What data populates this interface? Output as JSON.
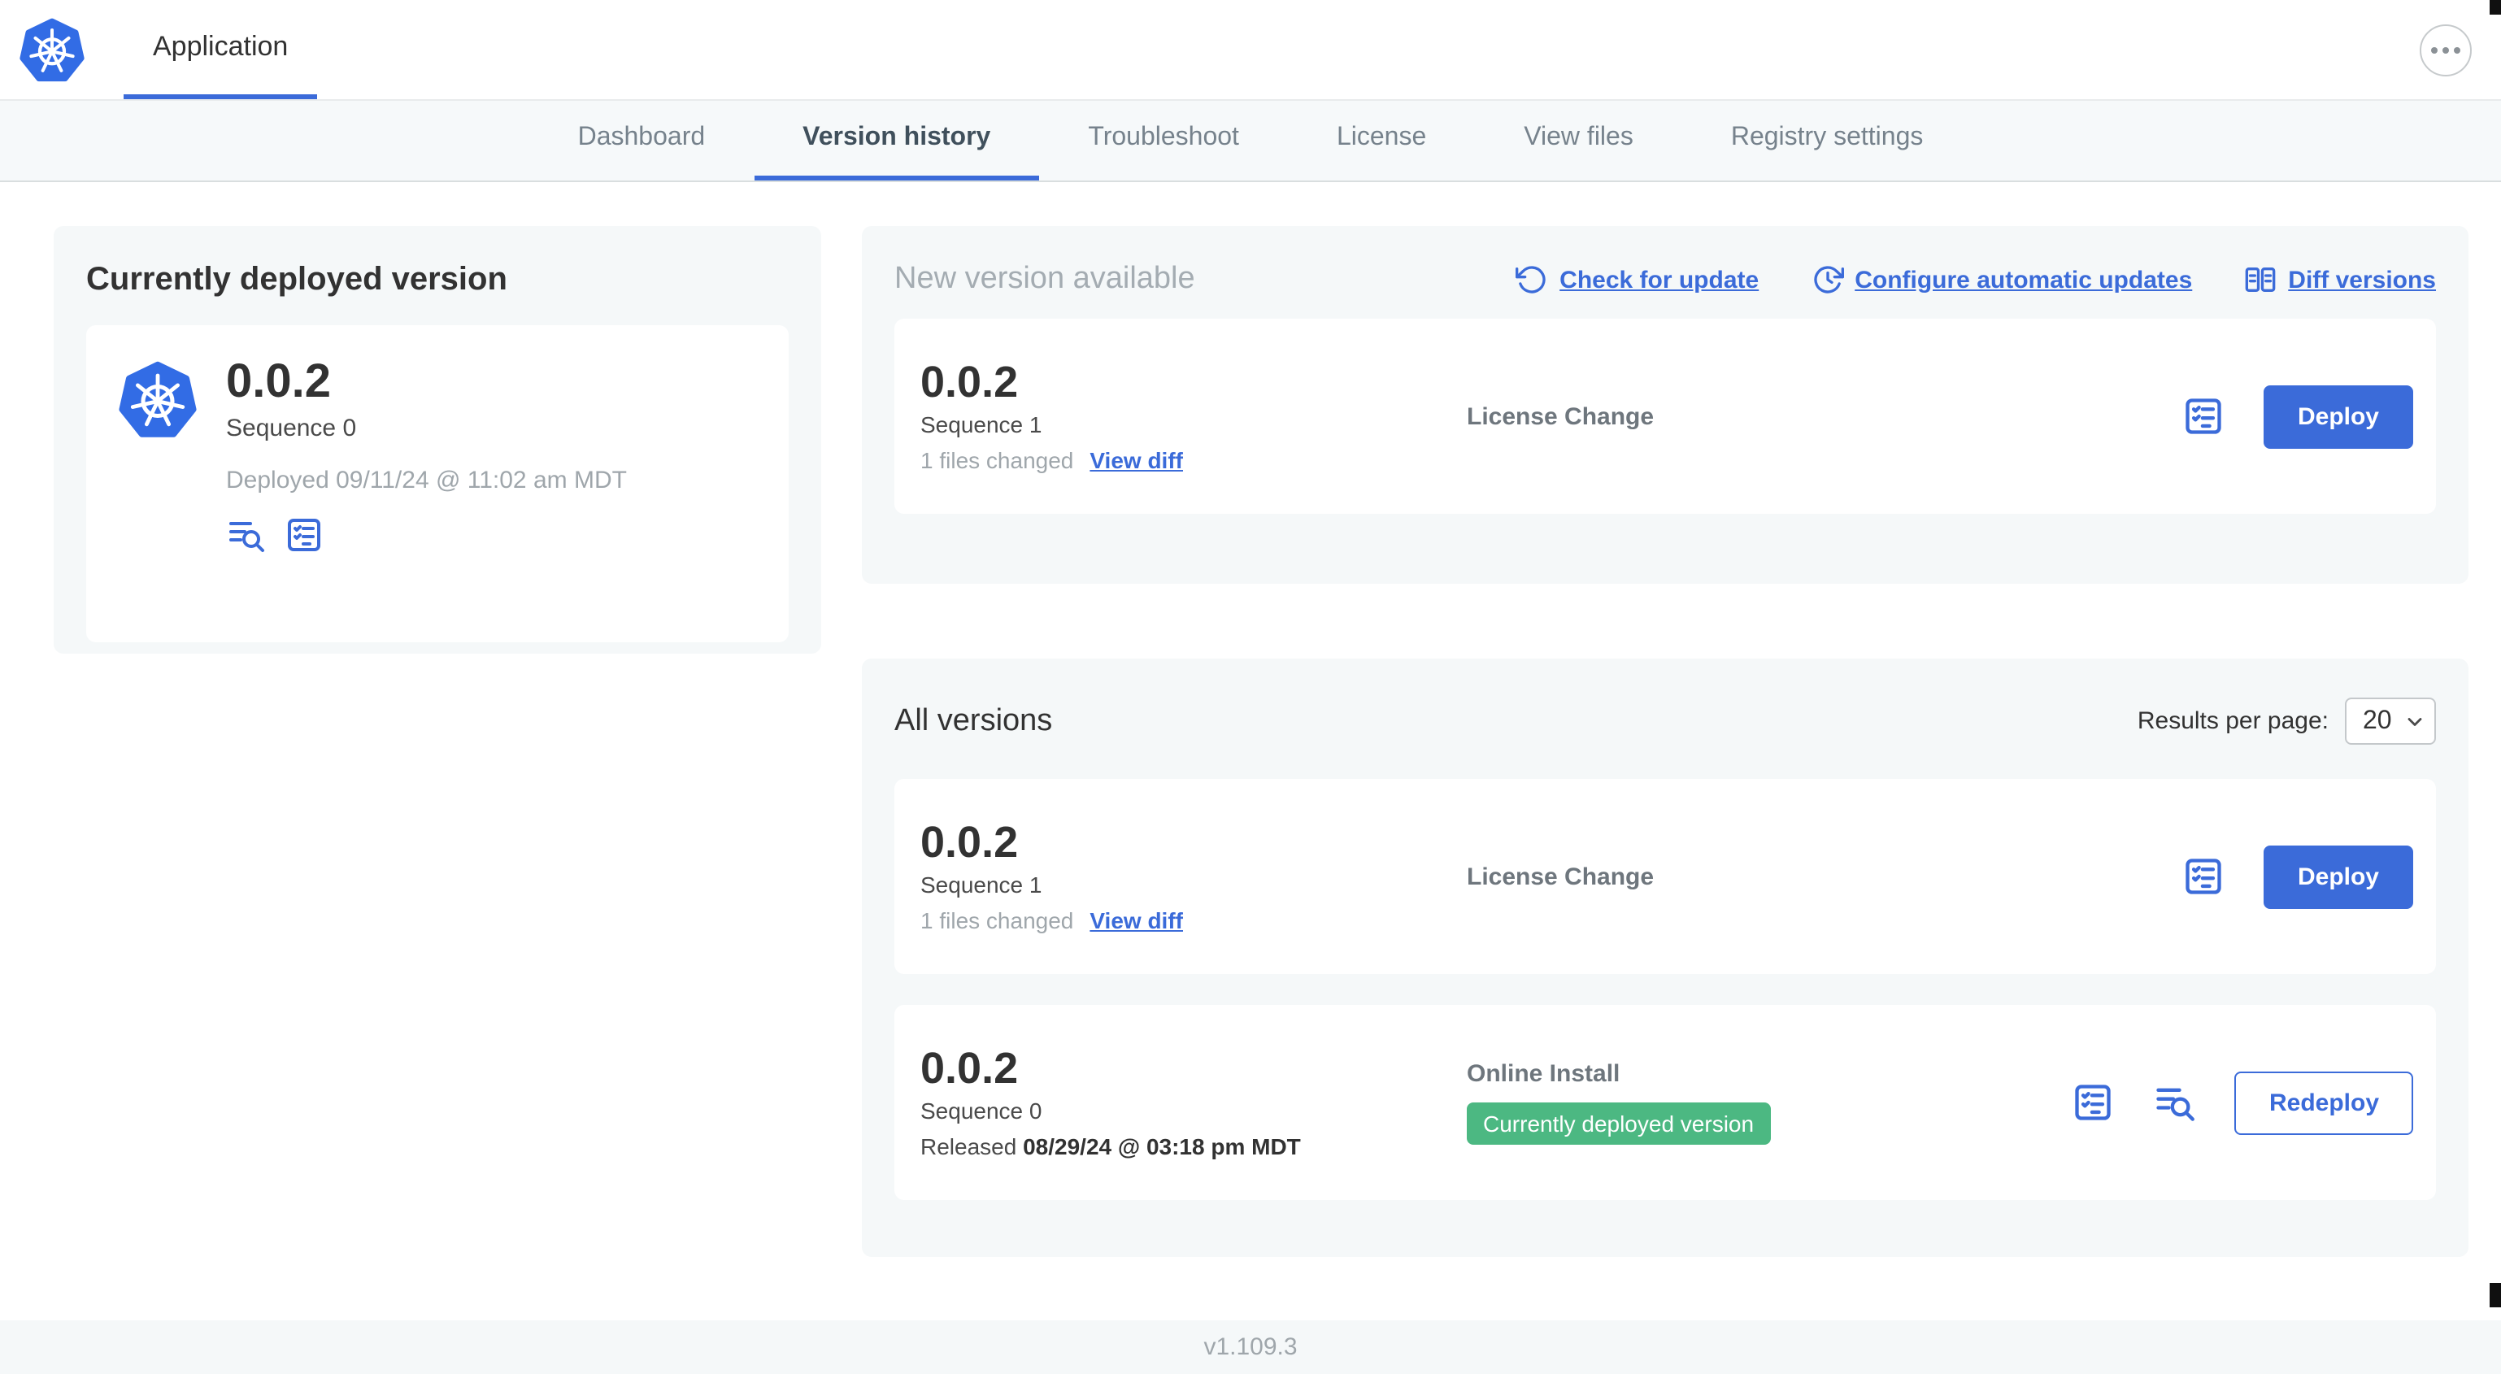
{
  "colors": {
    "accent_blue": "#3b6bd9",
    "logo_blue": "#326ce5",
    "badge_green": "#4cb882",
    "card_background": "#f5f8f9",
    "text_dark": "#323232",
    "text_muted": "#9fa6ab"
  },
  "header": {
    "app_label": "Application",
    "more_icon": "ellipsis-icon"
  },
  "nav": {
    "tabs": [
      "Dashboard",
      "Version history",
      "Troubleshoot",
      "License",
      "View files",
      "Registry settings"
    ],
    "active_tab": "Version history"
  },
  "current_version": {
    "title": "Currently deployed version",
    "version": "0.0.2",
    "sequence": "Sequence 0",
    "deployed": "Deployed 09/11/24 @ 11:02 am MDT",
    "icons": [
      "deploy-logs-icon",
      "preflight-checks-icon"
    ]
  },
  "new_version": {
    "title": "New version available",
    "check_for_update": "Check for update",
    "configure_auto_updates": "Configure automatic updates",
    "diff_versions": "Diff versions",
    "version": "0.0.2",
    "sequence": "Sequence 1",
    "files_changed": "1 files changed",
    "view_diff": "View diff",
    "source": "License Change",
    "deploy_label": "Deploy"
  },
  "all_versions": {
    "title": "All versions",
    "results_per_page_label": "Results per page:",
    "per_page": "20",
    "rows": [
      {
        "version": "0.0.2",
        "sequence": "Sequence 1",
        "files_changed": "1 files changed",
        "view_diff": "View diff",
        "source": "License Change",
        "action_label": "Deploy"
      },
      {
        "version": "0.0.2",
        "sequence": "Sequence 0",
        "released_label": "Released",
        "released_date": "08/29/24 @ 03:18 pm MDT",
        "source": "Online Install",
        "badge": "Currently deployed version",
        "action_label": "Redeploy"
      }
    ]
  },
  "footer": {
    "app_version": "v1.109.3"
  }
}
